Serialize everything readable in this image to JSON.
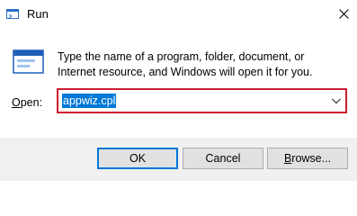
{
  "window": {
    "title": "Run",
    "close_icon": "close-icon",
    "app_icon": "run-app-icon"
  },
  "main": {
    "description": "Type the name of a program, folder, document, or Internet resource, and Windows will open it for you.",
    "open_label_prefix": "O",
    "open_label_rest": "pen:",
    "input_value": "appwiz.cpl"
  },
  "buttons": {
    "ok": "OK",
    "cancel": "Cancel",
    "browse_prefix": "B",
    "browse_rest": "rowse..."
  },
  "colors": {
    "highlight_border": "#cc1f2f",
    "selection": "#0078d7",
    "footer_bg": "#f0f0f0"
  }
}
